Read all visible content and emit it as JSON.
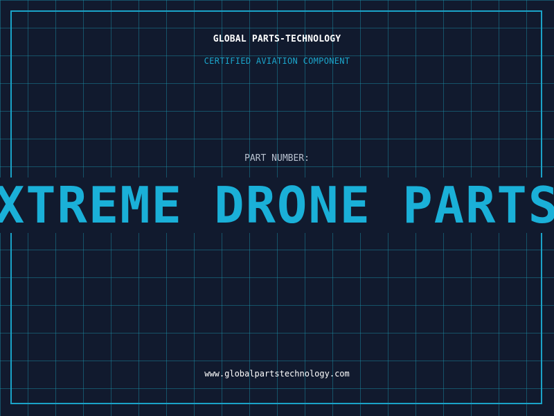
{
  "header": {
    "company": "GLOBAL PARTS-TECHNOLOGY",
    "tagline": "CERTIFIED AVIATION COMPONENT"
  },
  "part": {
    "label": "PART NUMBER:",
    "title": "XTREME DRONE PARTS"
  },
  "footer": {
    "website": "www.globalpartstechnology.com"
  },
  "colors": {
    "background": "#111a2e",
    "grid": "#1c96af",
    "accent": "#1ab0d8",
    "text_primary": "#ffffff",
    "text_muted": "#b9c2d0"
  }
}
